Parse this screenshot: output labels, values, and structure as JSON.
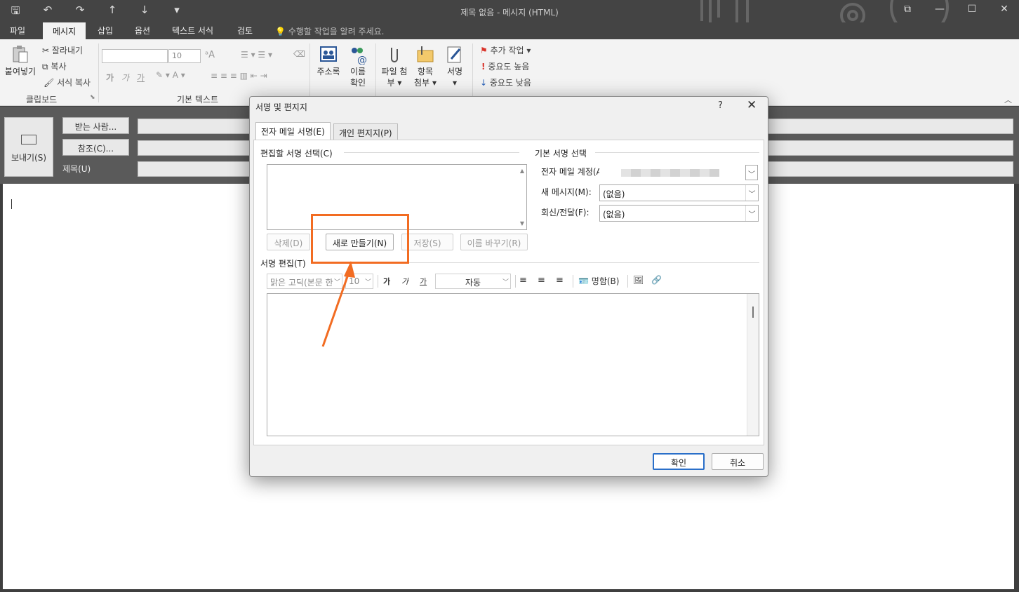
{
  "window": {
    "title": "제목 없음 - 메시지 (HTML)",
    "qat_icons": [
      "save-icon",
      "undo-icon",
      "redo-icon",
      "up-arrow-icon",
      "down-arrow-icon",
      "customize-icon"
    ],
    "qat_glyphs": [
      "🖫",
      "↶",
      "↷",
      "↑",
      "↓",
      "▾"
    ],
    "controls": {
      "restore": "⧉",
      "minimize": "—",
      "maximize": "☐",
      "close": "✕"
    }
  },
  "ribbon_tabs": {
    "file": "파일",
    "message": "메시지",
    "insert": "삽입",
    "options": "옵션",
    "format_text": "텍스트 서식",
    "review": "검토",
    "tell_me": "수행할 작업을 알려 주세요."
  },
  "ribbon": {
    "clipboard": {
      "paste": "붙여넣기",
      "cut": "잘라내기",
      "copy": "복사",
      "format_painter": "서식 복사",
      "group": "클립보드"
    },
    "basic_text": {
      "font_size": "10",
      "group": "기본 텍스트",
      "bold": "가",
      "italic": "가",
      "underline": "가"
    },
    "names": {
      "address_book": "주소록",
      "check_names_1": "이름",
      "check_names_2": "확인"
    },
    "include": {
      "attach_file_1": "파일 첨",
      "attach_file_2": "부",
      "attach_item_1": "항목",
      "attach_item_2": "첨부",
      "signature": "서명"
    },
    "tags": {
      "follow_up": "추가 작업",
      "high_importance": "중요도 높음",
      "low_importance": "중요도 낮음"
    }
  },
  "compose": {
    "send": "보내기(S)",
    "to": "받는 사람...",
    "cc": "참조(C)...",
    "subject": "제목(U)"
  },
  "dialog": {
    "title": "서명 및 편지지",
    "help": "?",
    "close": "✕",
    "tabs": {
      "email_signature": "전자 메일 서명(E)",
      "personal_stationery": "개인 편지지(P)"
    },
    "select_signature_label": "편집할 서명 선택(C)",
    "buttons": {
      "delete": "삭제(D)",
      "new": "새로 만들기(N)",
      "save": "저장(S)",
      "rename": "이름 바꾸기(R)"
    },
    "default_signature": {
      "label": "기본 서명 선택",
      "email_account_label": "전자 메일 계정(A):",
      "new_messages_label": "새 메시지(M):",
      "new_messages_value": "(없음)",
      "replies_label": "회신/전달(F):",
      "replies_value": "(없음)"
    },
    "edit_signature_label": "서명 편집(T)",
    "editor_toolbar": {
      "font": "맑은 고딕(본문 한",
      "size": "10",
      "bold": "가",
      "italic": "가",
      "underline": "가",
      "color": "자동",
      "business_card": "명함(B)"
    },
    "ok": "확인",
    "cancel": "취소"
  },
  "colors": {
    "accent_orange": "#f26c22",
    "focus_blue": "#2a6fc9",
    "flag_red": "#d9342b",
    "importance_red": "#d9342b",
    "importance_blue": "#2a62b8"
  }
}
